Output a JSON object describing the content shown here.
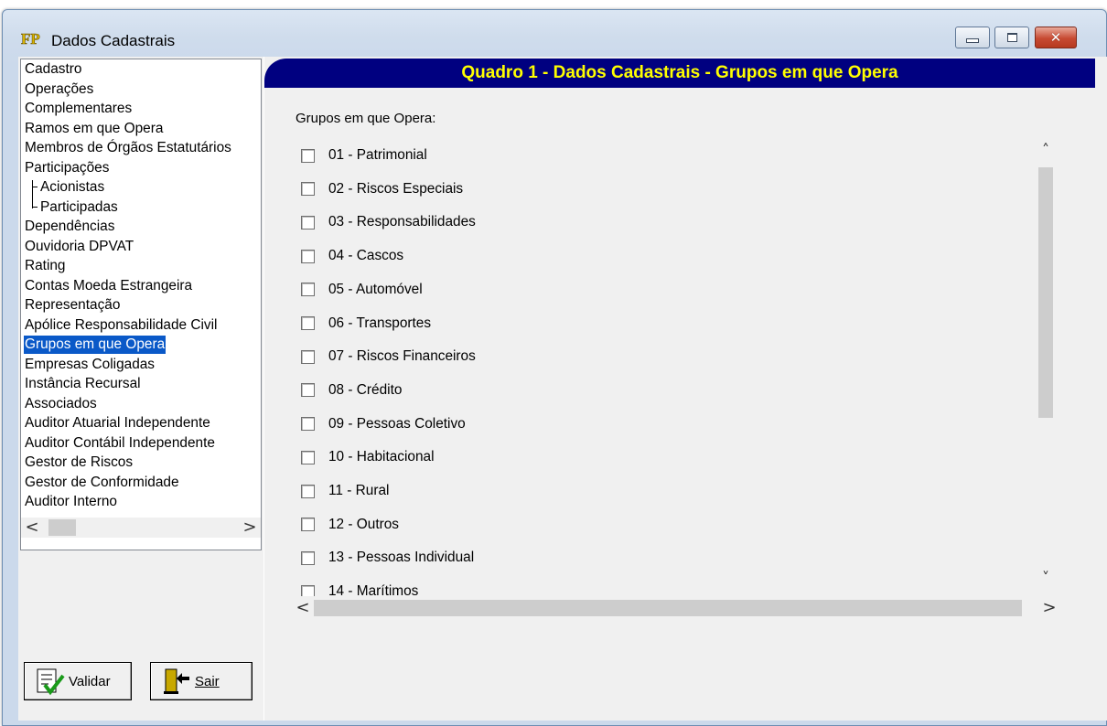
{
  "window": {
    "title": "Dados Cadastrais",
    "app_icon": "fp-logo-icon",
    "controls": {
      "minimize": "minimize-icon",
      "maximize": "maximize-icon",
      "close": "close-icon",
      "close_glyph": "✕"
    }
  },
  "nav": {
    "items": [
      {
        "label": "Cadastro"
      },
      {
        "label": "Operações"
      },
      {
        "label": "Complementares"
      },
      {
        "label": "Ramos em que Opera"
      },
      {
        "label": "Membros de Órgãos Estatutários"
      },
      {
        "label": "Participações"
      },
      {
        "label": "Acionistas",
        "child": true
      },
      {
        "label": "Participadas",
        "child": true
      },
      {
        "label": "Dependências"
      },
      {
        "label": "Ouvidoria DPVAT"
      },
      {
        "label": "Rating"
      },
      {
        "label": "Contas Moeda Estrangeira"
      },
      {
        "label": "Representação"
      },
      {
        "label": "Apólice Responsabilidade Civil"
      },
      {
        "label": "Grupos em que Opera",
        "selected": true
      },
      {
        "label": "Empresas Coligadas"
      },
      {
        "label": "Instância Recursal"
      },
      {
        "label": "Associados"
      },
      {
        "label": "Auditor Atuarial Independente"
      },
      {
        "label": "Auditor Contábil Independente"
      },
      {
        "label": "Gestor de Riscos"
      },
      {
        "label": "Gestor de Conformidade"
      },
      {
        "label": "Auditor Interno"
      }
    ],
    "scroll_left_glyph": "<",
    "scroll_right_glyph": ">"
  },
  "buttons": {
    "validar_label": "Validar",
    "sair_label": "Sair"
  },
  "main": {
    "header_title": "Quadro 1 - Dados Cadastrais - Grupos em que Opera",
    "section_label": "Grupos em que Opera:",
    "groups": [
      {
        "label": "01 - Patrimonial",
        "checked": false
      },
      {
        "label": "02 - Riscos Especiais",
        "checked": false
      },
      {
        "label": "03 - Responsabilidades",
        "checked": false
      },
      {
        "label": "04 - Cascos",
        "checked": false
      },
      {
        "label": "05 - Automóvel",
        "checked": false
      },
      {
        "label": "06 - Transportes",
        "checked": false
      },
      {
        "label": "07 - Riscos Financeiros",
        "checked": false
      },
      {
        "label": "08 - Crédito",
        "checked": false
      },
      {
        "label": "09 - Pessoas Coletivo",
        "checked": false
      },
      {
        "label": "10 - Habitacional",
        "checked": false
      },
      {
        "label": "11 - Rural",
        "checked": false
      },
      {
        "label": "12 - Outros",
        "checked": false
      },
      {
        "label": "13 - Pessoas Individual",
        "checked": false
      },
      {
        "label": "14 - Marítimos",
        "checked": false
      }
    ],
    "vscroll_up_glyph": "˄",
    "vscroll_down_glyph": "˅",
    "hscroll_left_glyph": "<",
    "hscroll_right_glyph": ">"
  },
  "colors": {
    "header_bg": "#000080",
    "header_text": "#ffff00",
    "selection_bg": "#0a59c8"
  }
}
